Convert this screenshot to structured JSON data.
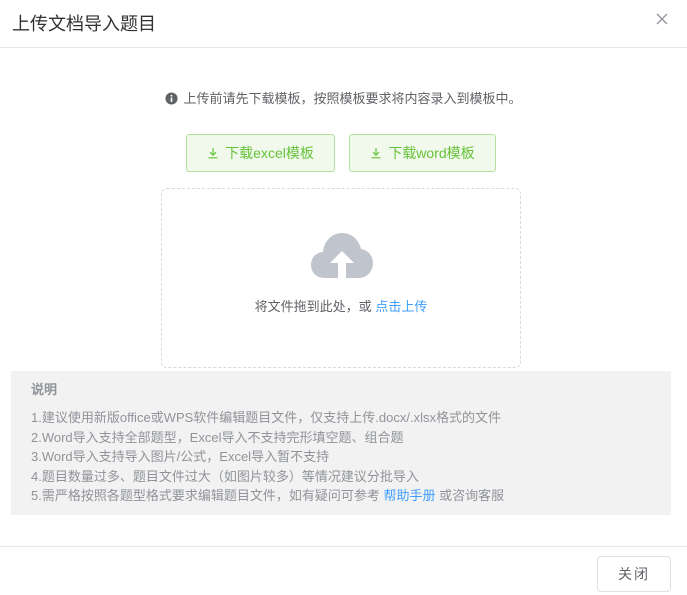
{
  "dialog": {
    "title": "上传文档导入题目",
    "close_icon": "close-icon"
  },
  "notice": {
    "icon": "info-icon",
    "text": "上传前请先下载模板，按照模板要求将内容录入到模板中。"
  },
  "downloads": {
    "excel_label": "下载excel模板",
    "word_label": "下载word模板",
    "icon": "download-icon",
    "accent": "#67c23a"
  },
  "upload": {
    "icon": "cloud-upload-icon",
    "prompt": "将文件拖到此处，或",
    "link": "点击上传",
    "link_color": "#409eff"
  },
  "notes": {
    "title": "说明",
    "items": [
      "1.建议使用新版office或WPS软件编辑题目文件，仅支持上传.docx/.xlsx格式的文件",
      "2.Word导入支持全部题型，Excel导入不支持完形填空题、组合题",
      "3.Word导入支持导入图片/公式，Excel导入暂不支持",
      "4.题目数量过多、题目文件过大（如图片较多）等情况建议分批导入"
    ],
    "item5_prefix": "5.需严格按照各题型格式要求编辑题目文件，如有疑问可参考",
    "item5_link": "帮助手册",
    "item5_suffix": "或咨询客服"
  },
  "footer": {
    "close_label": "关闭"
  }
}
